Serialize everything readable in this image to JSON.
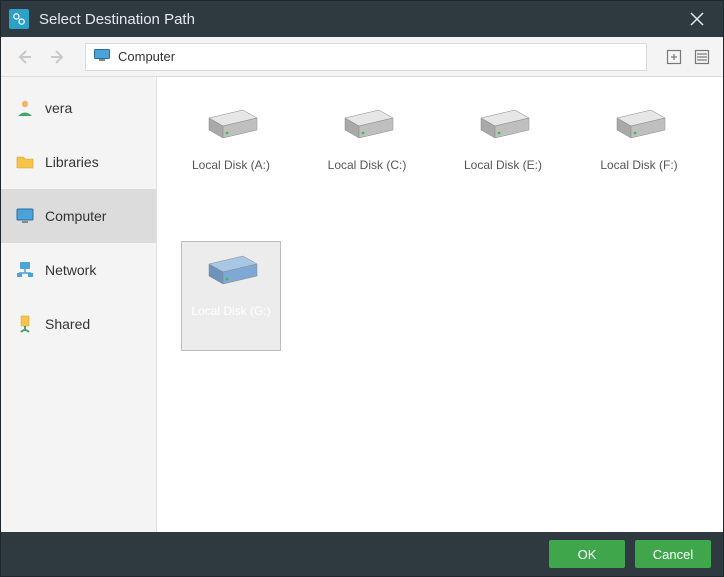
{
  "titlebar": {
    "title": "Select Destination Path"
  },
  "toolbar": {
    "breadcrumb_label": "Computer"
  },
  "sidebar": {
    "items": [
      {
        "label": "vera",
        "icon": "user",
        "selected": false
      },
      {
        "label": "Libraries",
        "icon": "folder",
        "selected": false
      },
      {
        "label": "Computer",
        "icon": "monitor",
        "selected": true
      },
      {
        "label": "Network",
        "icon": "network",
        "selected": false
      },
      {
        "label": "Shared",
        "icon": "shared",
        "selected": false
      }
    ]
  },
  "content": {
    "drives": [
      {
        "label": "Local Disk (A:)",
        "selected": false,
        "color": "gray"
      },
      {
        "label": "Local Disk (C:)",
        "selected": false,
        "color": "gray"
      },
      {
        "label": "Local Disk (E:)",
        "selected": false,
        "color": "gray"
      },
      {
        "label": "Local Disk (F:)",
        "selected": false,
        "color": "gray"
      },
      {
        "label": "Local Disk (G:)",
        "selected": true,
        "color": "blue"
      }
    ]
  },
  "footer": {
    "ok_label": "OK",
    "cancel_label": "Cancel"
  }
}
